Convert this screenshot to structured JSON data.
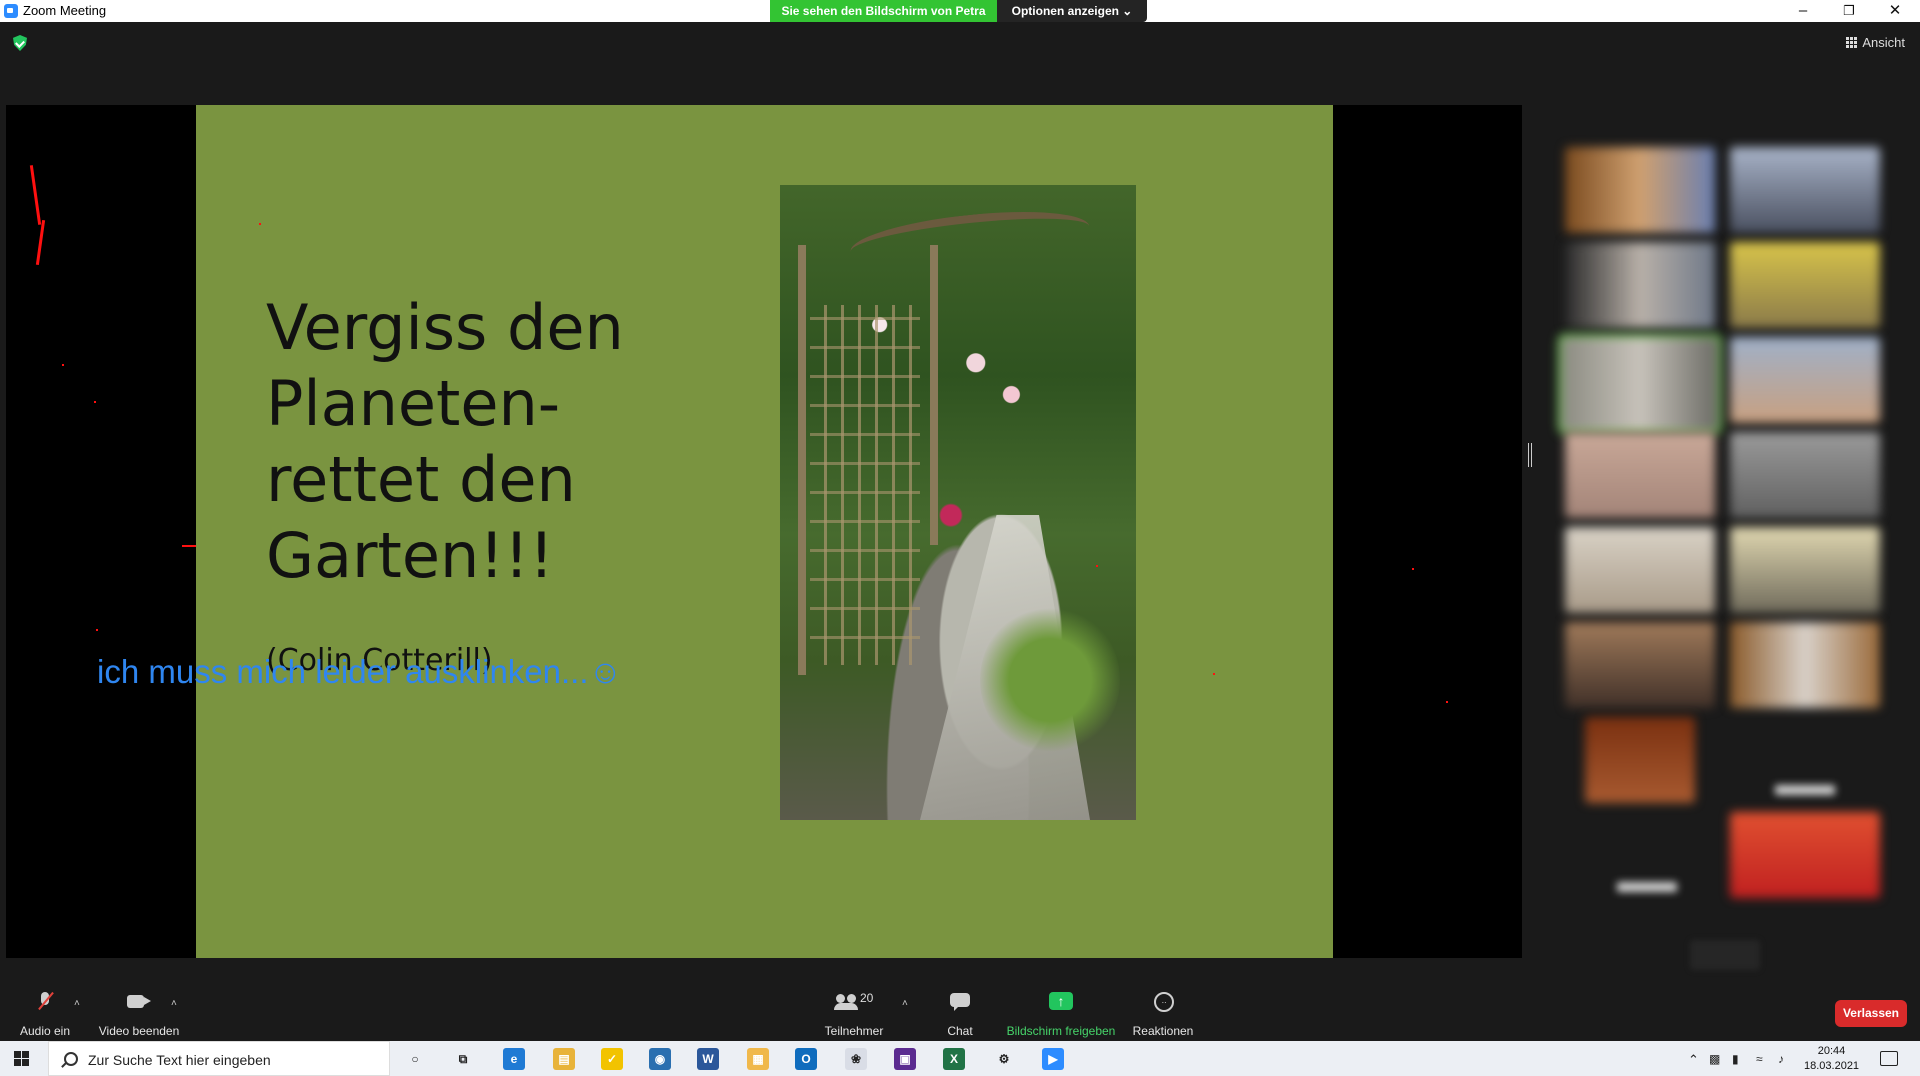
{
  "window": {
    "title": "Zoom Meeting",
    "share_banner": "Sie sehen den Bildschirm von Petra",
    "options_label": "Optionen anzeigen ⌄",
    "controls": [
      "–",
      "❐",
      "✕"
    ]
  },
  "meeting": {
    "view_label": "Ansicht"
  },
  "slide": {
    "title_lines": [
      "Vergiss den",
      "Planeten-",
      "rettet den",
      "Garten!!!"
    ],
    "author": "(Colin Cotterill)",
    "photo_alt": "Gartenweg mit Rosenbogen"
  },
  "caption": "ich muss mich leider ausklinken...☺",
  "toolbar": {
    "audio_label": "Audio ein",
    "video_label": "Video beenden",
    "participants_label": "Teilnehmer",
    "participants_count": "20",
    "chat_label": "Chat",
    "share_label": "Bildschirm freigeben",
    "reactions_label": "Reaktionen",
    "leave_label": "Verlassen",
    "caret": "˄"
  },
  "taskbar": {
    "search_placeholder": "Zur Suche Text hier eingeben",
    "time": "20:44",
    "date": "18.03.2021",
    "apps": [
      {
        "name": "cortana",
        "glyph": "○",
        "color": "#eceff4"
      },
      {
        "name": "task-view",
        "glyph": "⧉",
        "color": "#eceff4"
      },
      {
        "name": "edge",
        "glyph": "e",
        "color": "#1f7ad4"
      },
      {
        "name": "file-explorer",
        "glyph": "▤",
        "color": "#e8b33a"
      },
      {
        "name": "norton",
        "glyph": "✓",
        "color": "#f2c300"
      },
      {
        "name": "camera",
        "glyph": "◉",
        "color": "#2a6fb0"
      },
      {
        "name": "word",
        "glyph": "W",
        "color": "#2b579a"
      },
      {
        "name": "explorer-folder",
        "glyph": "▦",
        "color": "#f0b84b"
      },
      {
        "name": "outlook",
        "glyph": "O",
        "color": "#0f6cbd"
      },
      {
        "name": "paint",
        "glyph": "❀",
        "color": "#d9dde6"
      },
      {
        "name": "photo-app",
        "glyph": "▣",
        "color": "#5b2b90"
      },
      {
        "name": "excel",
        "glyph": "X",
        "color": "#217346"
      },
      {
        "name": "settings",
        "glyph": "⚙",
        "color": "#eceff4"
      },
      {
        "name": "zoom",
        "glyph": "▶",
        "color": "#2d8cff"
      }
    ]
  },
  "colors": {
    "slide_bg": "#7a9440",
    "share_banner": "#33c433",
    "leave_button": "#d92b2b",
    "share_icon": "#22c55e",
    "caption_blue": "#2f86f0",
    "annotation_red": "#ff1010"
  }
}
